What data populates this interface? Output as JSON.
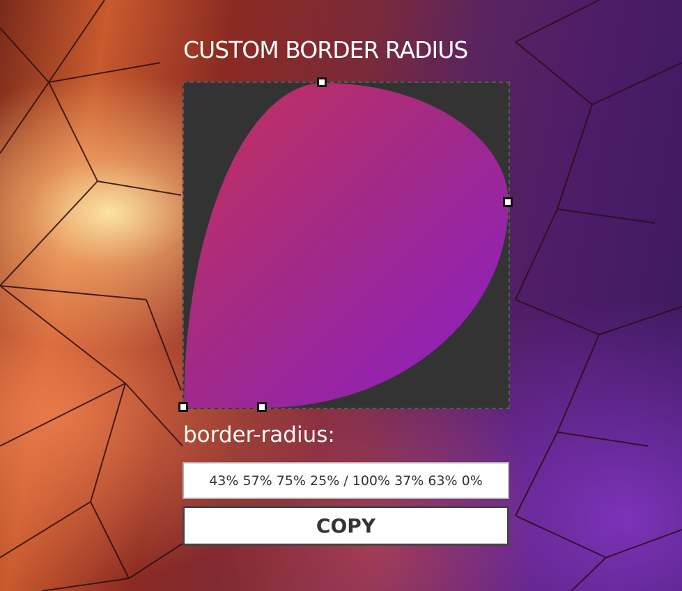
{
  "title": "CUSTOM BORDER RADIUS",
  "editor": {
    "shape_gradient": [
      "#c8325a",
      "#8a1ec8"
    ],
    "editor_background": "#333333",
    "handles": [
      "top-handle",
      "right-handle",
      "bottom-handle",
      "left-handle"
    ]
  },
  "output": {
    "label": "border-radius:",
    "value": "43% 57% 75% 25% / 100% 37% 63% 0%"
  },
  "copy_button": {
    "label": "COPY"
  }
}
